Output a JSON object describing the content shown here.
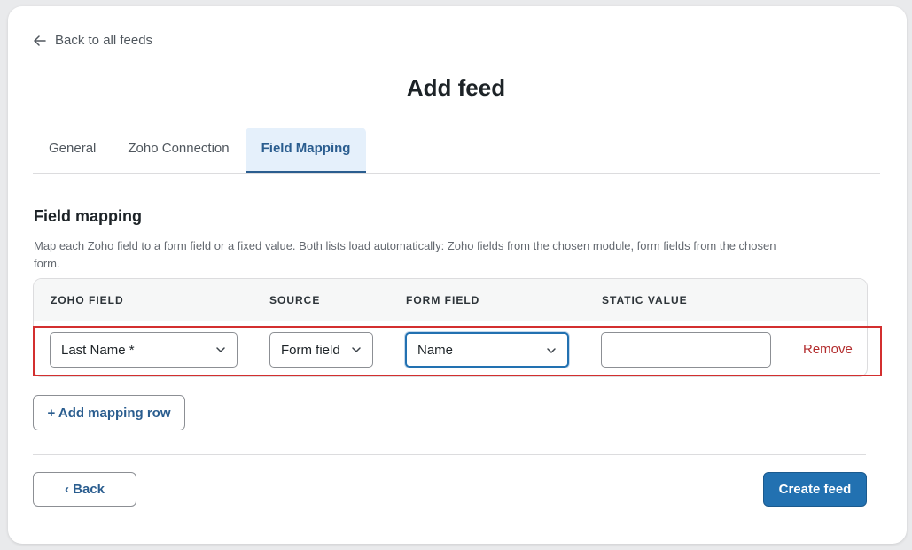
{
  "nav": {
    "back_label": "Back to all feeds"
  },
  "page": {
    "title": "Add feed"
  },
  "tabs": [
    {
      "label": "General",
      "active": false
    },
    {
      "label": "Zoho Connection",
      "active": false
    },
    {
      "label": "Field Mapping",
      "active": true
    }
  ],
  "section": {
    "title": "Field mapping",
    "description": "Map each Zoho field to a form field or a fixed value. Both lists load automatically: Zoho fields from the chosen module, form fields from the chosen form."
  },
  "mapping_table": {
    "columns": [
      "ZOHO FIELD",
      "SOURCE",
      "FORM FIELD",
      "STATIC VALUE"
    ],
    "rows": [
      {
        "zoho_field": "Last Name *",
        "source": "Form field",
        "form_field": "Name",
        "static_value": "",
        "remove_label": "Remove"
      }
    ]
  },
  "actions": {
    "add_row_label": "+ Add mapping row",
    "back_label": "‹ Back",
    "create_label": "Create feed"
  },
  "colors": {
    "accent": "#2271b1",
    "tab_active_bg": "#e5f0fb",
    "danger": "#b32d2e",
    "highlight": "#d32f2f"
  },
  "icons": {
    "back": "arrow-left-icon",
    "dropdown": "chevron-down-icon"
  }
}
